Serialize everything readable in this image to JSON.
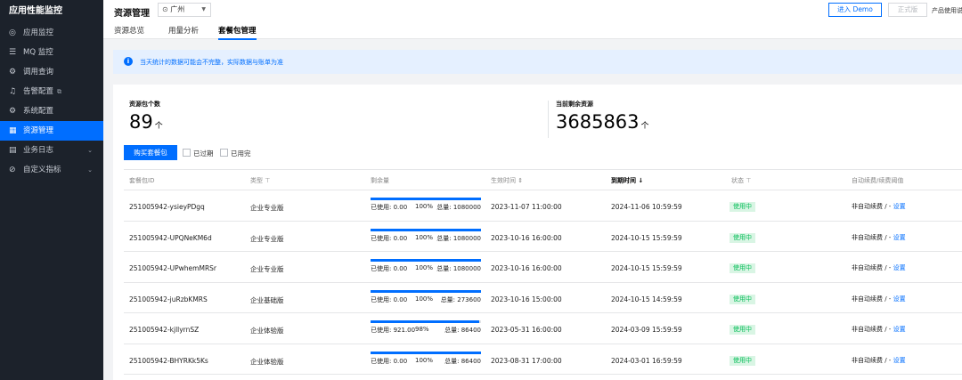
{
  "sidebar": {
    "brand": "应用性能监控",
    "items": [
      {
        "label": "应用监控",
        "icon": "eye-icon",
        "glyph": "◎"
      },
      {
        "label": "MQ 监控",
        "icon": "mq-icon",
        "glyph": "☰"
      },
      {
        "label": "调用查询",
        "icon": "gear-icon",
        "glyph": "⚙"
      },
      {
        "label": "告警配置",
        "icon": "alarm-icon",
        "glyph": "♫",
        "external": "⧉"
      },
      {
        "label": "系统配置",
        "icon": "settings-icon",
        "glyph": "⚙"
      },
      {
        "label": "资源管理",
        "icon": "grid-icon",
        "glyph": "▦",
        "active": true
      },
      {
        "label": "业务日志",
        "icon": "log-icon",
        "glyph": "▤",
        "chevron": "⌄"
      },
      {
        "label": "自定义指标",
        "icon": "check-circle-icon",
        "glyph": "⊘",
        "chevron": "⌄"
      }
    ]
  },
  "header": {
    "title": "资源管理",
    "region": "广州",
    "region_icon": "location-pin-icon",
    "tabs": [
      "资源总览",
      "用量分析",
      "套餐包管理"
    ],
    "active_tab": 2,
    "demo_button": "进入 Demo",
    "official_button": "正式版",
    "usage_guide": "产品使用说"
  },
  "notice": {
    "text": "当天统计的数据可能会不完整，实际数据与账单为准"
  },
  "stats": {
    "packages_label": "资源包个数",
    "packages_value": "89",
    "packages_unit": "个",
    "remaining_label": "当前剩余资源",
    "remaining_value": "3685863",
    "remaining_unit": "个"
  },
  "actions": {
    "buy_button": "购买套餐包",
    "expired_label": "已过期",
    "usedup_label": "已用完"
  },
  "table": {
    "columns": [
      "套餐包ID",
      "类型 ⊤",
      "剩余量",
      "生效时间 ⇕",
      "到期时间 ↓",
      "状态 ⊤",
      "自动续费/续费阈值"
    ],
    "rows": [
      {
        "id": "251005942-ysieyPDgq",
        "type": "企业专业版",
        "used": "已使用: 0.00",
        "pct": "100%",
        "remaining_fraction": 1.0,
        "total": "总量: 1080000",
        "start": "2023-11-07 11:00:00",
        "end": "2024-11-06 10:59:59",
        "status": "使用中",
        "renew": "非自动续费 / -",
        "renew_link": "设置"
      },
      {
        "id": "251005942-UPQNeKM6d",
        "type": "企业专业版",
        "used": "已使用: 0.00",
        "pct": "100%",
        "remaining_fraction": 1.0,
        "total": "总量: 1080000",
        "start": "2023-10-16 16:00:00",
        "end": "2024-10-15 15:59:59",
        "status": "使用中",
        "renew": "非自动续费 / -",
        "renew_link": "设置"
      },
      {
        "id": "251005942-UPwhemMRSr",
        "type": "企业专业版",
        "used": "已使用: 0.00",
        "pct": "100%",
        "remaining_fraction": 1.0,
        "total": "总量: 1080000",
        "start": "2023-10-16 16:00:00",
        "end": "2024-10-15 15:59:59",
        "status": "使用中",
        "renew": "非自动续费 / -",
        "renew_link": "设置"
      },
      {
        "id": "251005942-juRzbKMRS",
        "type": "企业基础版",
        "used": "已使用: 0.00",
        "pct": "100%",
        "remaining_fraction": 1.0,
        "total": "总量: 273600",
        "start": "2023-10-16 15:00:00",
        "end": "2024-10-15 14:59:59",
        "status": "使用中",
        "renew": "非自动续费 / -",
        "renew_link": "设置"
      },
      {
        "id": "251005942-kjllyrnSZ",
        "type": "企业体验版",
        "used": "已使用: 921.00",
        "pct": "98%",
        "remaining_fraction": 0.98,
        "total": "总量: 86400",
        "start": "2023-05-31 16:00:00",
        "end": "2024-03-09 15:59:59",
        "status": "使用中",
        "renew": "非自动续费 / -",
        "renew_link": "设置"
      },
      {
        "id": "251005942-BHYRKk5Ks",
        "type": "企业体验版",
        "used": "已使用: 0.00",
        "pct": "100%",
        "remaining_fraction": 1.0,
        "total": "总量: 86400",
        "start": "2023-08-31 17:00:00",
        "end": "2024-03-01 16:59:59",
        "status": "使用中",
        "renew": "非自动续费 / -",
        "renew_link": "设置"
      }
    ]
  }
}
